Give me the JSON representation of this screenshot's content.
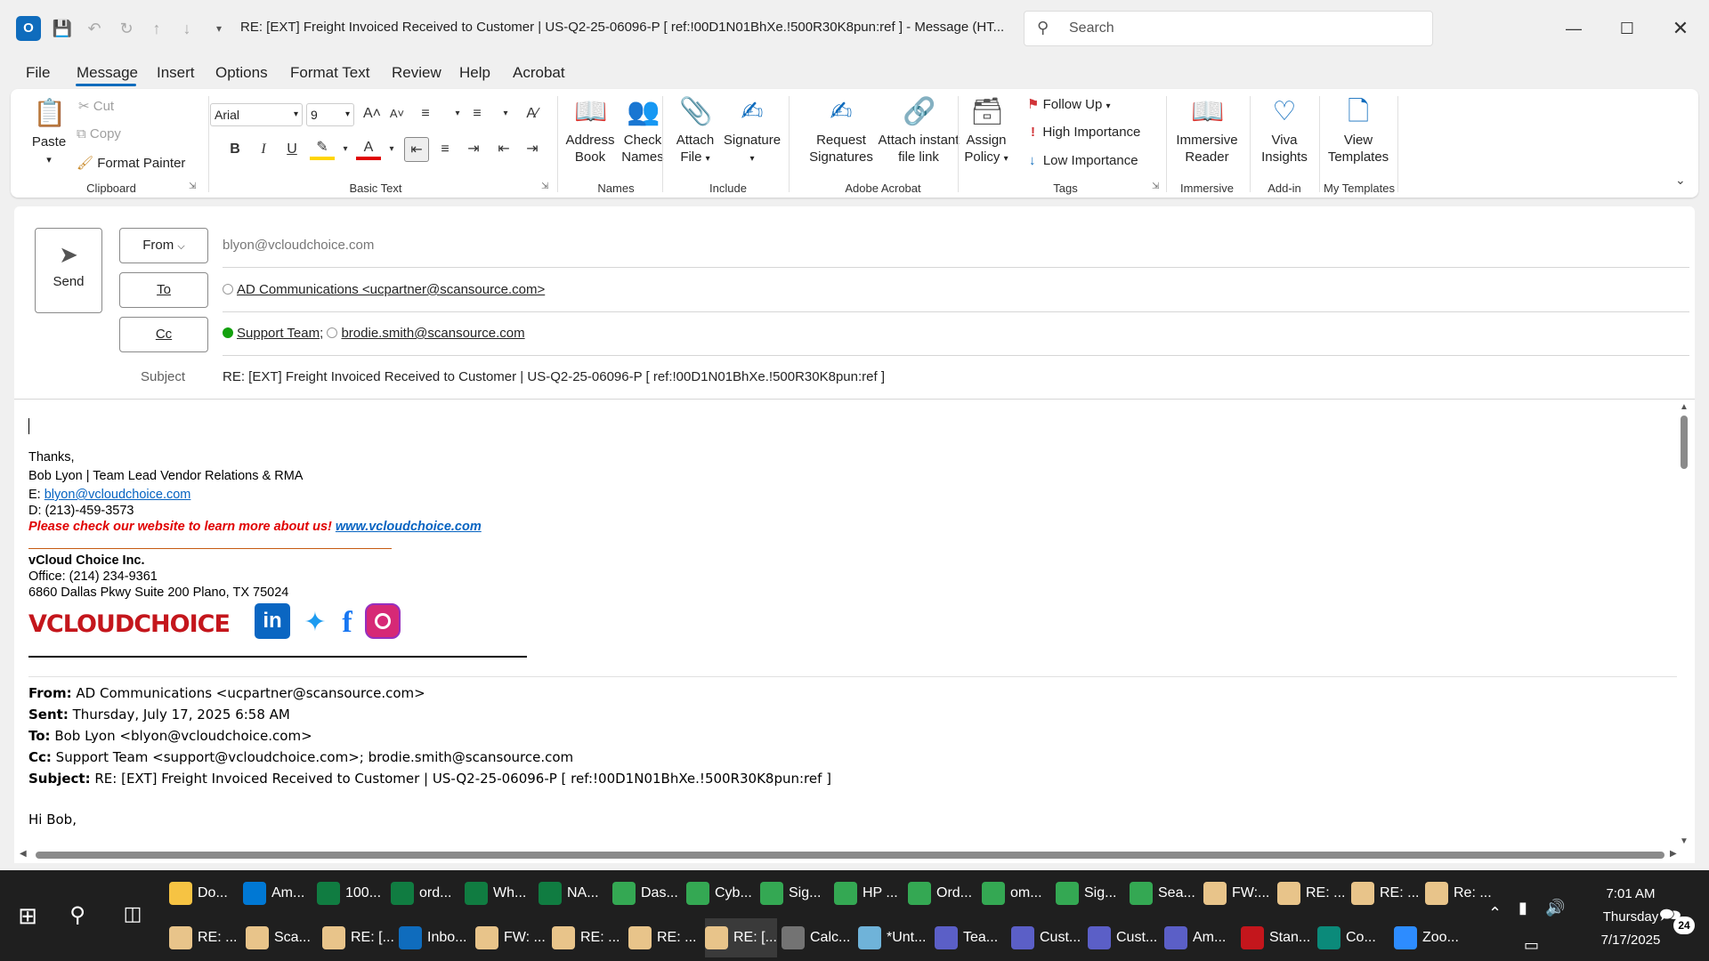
{
  "window": {
    "title": "RE: [EXT] Freight Invoiced Received to Customer | US-Q2-25-06096-P    [ ref:!00D1N01BhXe.!500R30K8pun:ref ]  -  Message (HT...",
    "search_placeholder": "Search"
  },
  "menu": [
    "File",
    "Message",
    "Insert",
    "Options",
    "Format Text",
    "Review",
    "Help",
    "Acrobat"
  ],
  "ribbon": {
    "clipboard": {
      "paste": "Paste",
      "cut": "Cut",
      "copy": "Copy",
      "format_painter": "Format Painter",
      "group": "Clipboard"
    },
    "basic_text": {
      "font": "Arial",
      "size": "9",
      "bold": "B",
      "italic": "I",
      "underline": "U",
      "group": "Basic Text"
    },
    "names": {
      "address_book_1": "Address",
      "address_book_2": "Book",
      "check_names_1": "Check",
      "check_names_2": "Names",
      "group": "Names"
    },
    "include": {
      "attach_1": "Attach",
      "attach_2": "File",
      "signature": "Signature",
      "group": "Include"
    },
    "acrobat": {
      "request_1": "Request",
      "request_2": "Signatures",
      "attach_link_1": "Attach instant",
      "attach_link_2": "file link",
      "group": "Adobe Acrobat"
    },
    "tags": {
      "assign_1": "Assign",
      "assign_2": "Policy",
      "follow_up": "Follow Up",
      "high": "High Importance",
      "low": "Low Importance",
      "group": "Tags"
    },
    "immersive": {
      "label_1": "Immersive",
      "label_2": "Reader",
      "group": "Immersive"
    },
    "addin": {
      "label_1": "Viva",
      "label_2": "Insights",
      "group": "Add-in"
    },
    "templates": {
      "label_1": "View",
      "label_2": "Templates",
      "group": "My Templates"
    }
  },
  "compose": {
    "send": "Send",
    "from_label": "From",
    "from_value": "blyon@vcloudchoice.com",
    "to_label": "To",
    "to_value": "AD Communications <ucpartner@scansource.com>",
    "cc_label": "Cc",
    "cc_value_1": "Support Team",
    "cc_sep": ";",
    "cc_value_2": "brodie.smith@scansource.com",
    "subject_label": "Subject",
    "subject_value": "RE: [EXT] Freight Invoiced Received to Customer | US-Q2-25-06096-P    [ ref:!00D1N01BhXe.!500R30K8pun:ref ]"
  },
  "signature": {
    "thanks": "Thanks,",
    "name_line": "Bob Lyon | Team Lead Vendor Relations & RMA",
    "email_prefix": "E: ",
    "email": "blyon@vcloudchoice.com",
    "phone": "D: (213)-459-3573",
    "promo": "Please check our website to learn more about us! ",
    "website": "www.vcloudchoice.com",
    "company": "vCloud Choice Inc.",
    "office": "Office: (214) 234-9361",
    "address": "6860 Dallas Pkwy Suite 200 Plano, TX 75024",
    "logo_text": "VCLOUDCHOICE"
  },
  "quoted": {
    "from_label": "From:",
    "from": " AD Communications <ucpartner@scansource.com>",
    "sent_label": "Sent:",
    "sent": " Thursday, July 17, 2025 6:58 AM",
    "to_label": "To:",
    "to": " Bob Lyon <blyon@vcloudchoice.com>",
    "cc_label": "Cc:",
    "cc": " Support Team <support@vcloudchoice.com>; brodie.smith@scansource.com",
    "subject_label": "Subject:",
    "subject": " RE: [EXT] Freight Invoiced Received to Customer | US-Q2-25-06096-P [ ref:!00D1N01BhXe.!500R30K8pun:ref ]",
    "greeting": "Hi Bob,"
  },
  "taskbar": {
    "row1": [
      "Do...",
      "Am...",
      "100...",
      "ord...",
      "Wh...",
      "NA...",
      "Das...",
      "Cyb...",
      "Sig...",
      "HP ...",
      "Ord...",
      "om...",
      "Sig...",
      "Sea...",
      "FW:...",
      "RE: ...",
      "RE: ...",
      "Re: ..."
    ],
    "row2": [
      "RE: ...",
      "Sca...",
      "RE: [...",
      "Inbo...",
      "FW: ...",
      "RE: ...",
      "RE: ...",
      "RE: [...",
      "Calc...",
      "*Unt...",
      "Tea...",
      "Cust...",
      "Cust...",
      "Am...",
      "Stan...",
      "Co...",
      "Zoo..."
    ],
    "time": "7:01 AM",
    "day": "Thursday",
    "date": "7/17/2025",
    "notif": "24"
  }
}
